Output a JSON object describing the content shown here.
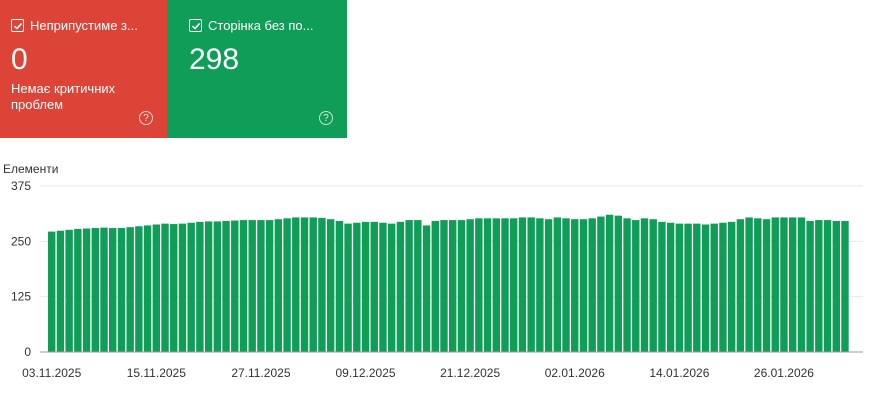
{
  "colors": {
    "error": "#db4437",
    "valid": "#0f9d58",
    "bar": "#109d58",
    "grid": "#e8e8e8"
  },
  "cards": {
    "error": {
      "label": "Неприпустиме з...",
      "count": "0",
      "subtitle": "Немає критичних проблем",
      "checked": true,
      "help_icon": "help-circle-icon"
    },
    "valid": {
      "label": "Сторінка без по...",
      "count": "298",
      "checked": true,
      "help_icon": "help-circle-icon"
    }
  },
  "chart_data": {
    "type": "bar",
    "ylabel": "Елементи",
    "yticks": [
      "375",
      "250",
      "125",
      "0"
    ],
    "ylim": [
      0,
      375
    ],
    "grid": true,
    "xticks": [
      "03.11.2025",
      "15.11.2025",
      "27.11.2025",
      "09.12.2025",
      "21.12.2025",
      "02.01.2026",
      "14.01.2026",
      "26.01.2026"
    ],
    "values": [
      272,
      274,
      276,
      278,
      279,
      280,
      281,
      280,
      280,
      282,
      284,
      286,
      288,
      290,
      289,
      290,
      292,
      294,
      295,
      295,
      296,
      297,
      298,
      298,
      298,
      298,
      300,
      302,
      304,
      304,
      304,
      303,
      300,
      296,
      290,
      292,
      294,
      294,
      292,
      290,
      294,
      298,
      298,
      286,
      296,
      298,
      298,
      298,
      300,
      302,
      302,
      302,
      302,
      302,
      304,
      304,
      302,
      300,
      304,
      302,
      300,
      300,
      302,
      306,
      310,
      308,
      302,
      298,
      302,
      300,
      294,
      292,
      290,
      290,
      290,
      288,
      290,
      292,
      294,
      300,
      304,
      302,
      300,
      304,
      304,
      304,
      304,
      296,
      298,
      298,
      296,
      296
    ]
  }
}
